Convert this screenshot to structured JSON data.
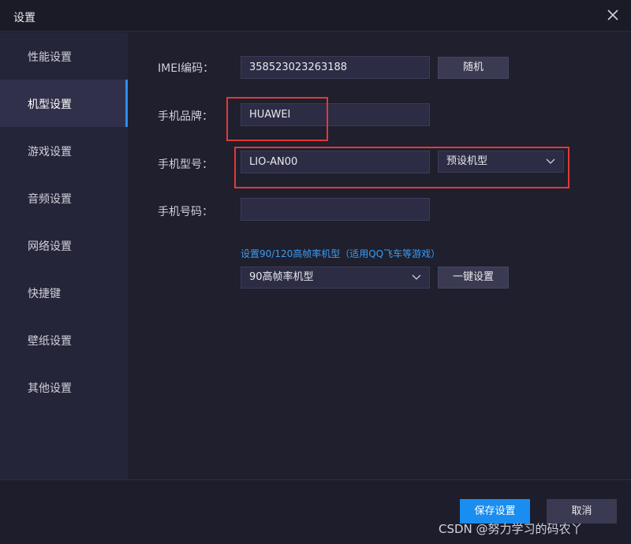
{
  "window": {
    "title": "设置"
  },
  "sidebar": {
    "items": [
      {
        "label": "性能设置"
      },
      {
        "label": "机型设置",
        "active": true
      },
      {
        "label": "游戏设置"
      },
      {
        "label": "音频设置"
      },
      {
        "label": "网络设置"
      },
      {
        "label": "快捷键"
      },
      {
        "label": "壁纸设置"
      },
      {
        "label": "其他设置"
      }
    ]
  },
  "form": {
    "imei_label": "IMEI编码：",
    "imei_value": "358523023263188",
    "random_button": "随机",
    "brand_label": "手机品牌：",
    "brand_value": "HUAWEI",
    "model_label": "手机型号：",
    "model_value": "LIO-AN00",
    "preset_select": "预设机型",
    "phone_label": "手机号码：",
    "phone_value": "",
    "hfr_link": "设置90/120高帧率机型（适用QQ飞车等游戏）",
    "hfr_select": "90高帧率机型",
    "one_key_button": "一键设置"
  },
  "footer": {
    "save_button": "保存设置",
    "cancel_button": "取消"
  },
  "watermark": "CSDN @努力学习的码农丫",
  "colors": {
    "accent": "#1a8df0",
    "highlight_box": "#e03a3a"
  }
}
